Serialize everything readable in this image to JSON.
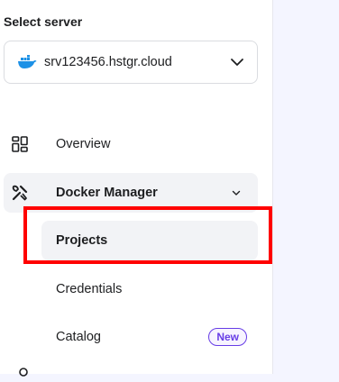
{
  "sidebar": {
    "server_section_title": "Select server",
    "server_select": {
      "value": "srv123456.hstgr.cloud",
      "icon": "docker-icon"
    },
    "nav": {
      "overview": {
        "label": "Overview",
        "icon": "grid-icon"
      },
      "docker_manager": {
        "label": "Docker Manager",
        "icon": "tools-icon",
        "expanded": true,
        "children": {
          "projects": {
            "label": "Projects",
            "active": true
          },
          "credentials": {
            "label": "Credentials"
          },
          "catalog": {
            "label": "Catalog",
            "badge": "New"
          }
        }
      }
    }
  },
  "colors": {
    "accent": "#673de6",
    "docker_blue": "#1d91e6",
    "highlight": "#ff0000",
    "active_bg": "#f2f3f6",
    "page_bg": "#f4f5ff"
  }
}
